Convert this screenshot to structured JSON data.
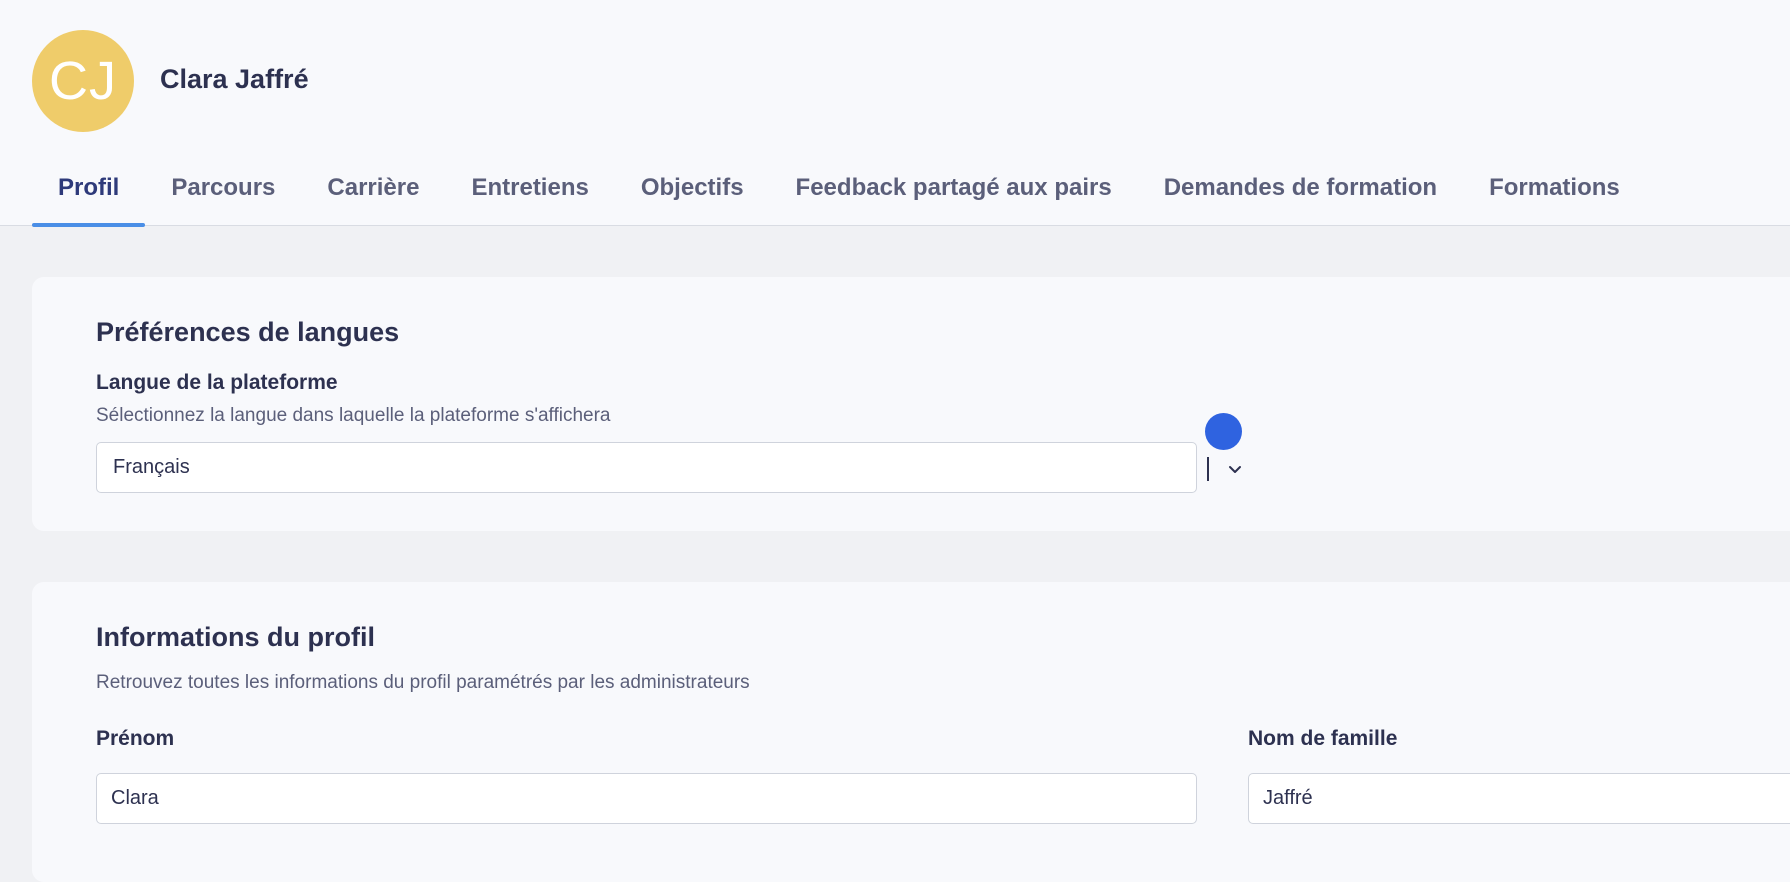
{
  "user": {
    "initials": "CJ",
    "name": "Clara Jaffré",
    "avatar_color": "#efcc6a"
  },
  "tabs": [
    {
      "label": "Profil",
      "active": true
    },
    {
      "label": "Parcours",
      "active": false
    },
    {
      "label": "Carrière",
      "active": false
    },
    {
      "label": "Entretiens",
      "active": false
    },
    {
      "label": "Objectifs",
      "active": false
    },
    {
      "label": "Feedback partagé aux pairs",
      "active": false
    },
    {
      "label": "Demandes de formation",
      "active": false
    },
    {
      "label": "Formations",
      "active": false
    }
  ],
  "language_section": {
    "title": "Préférences de langues",
    "field_label": "Langue de la plateforme",
    "field_help": "Sélectionnez la langue dans laquelle la plateforme s'affichera",
    "selected_value": "Français",
    "chevron_icon": "chevron-down-icon"
  },
  "profile_section": {
    "title": "Informations du profil",
    "description": "Retrouvez toutes les informations du profil paramétrés par les administrateurs",
    "first_name_label": "Prénom",
    "first_name_value": "Clara",
    "last_name_label": "Nom de famille",
    "last_name_value": "Jaffré"
  },
  "colors": {
    "accent": "#4a8ee6",
    "indicator": "#2f63e0",
    "text": "#2d3150"
  }
}
